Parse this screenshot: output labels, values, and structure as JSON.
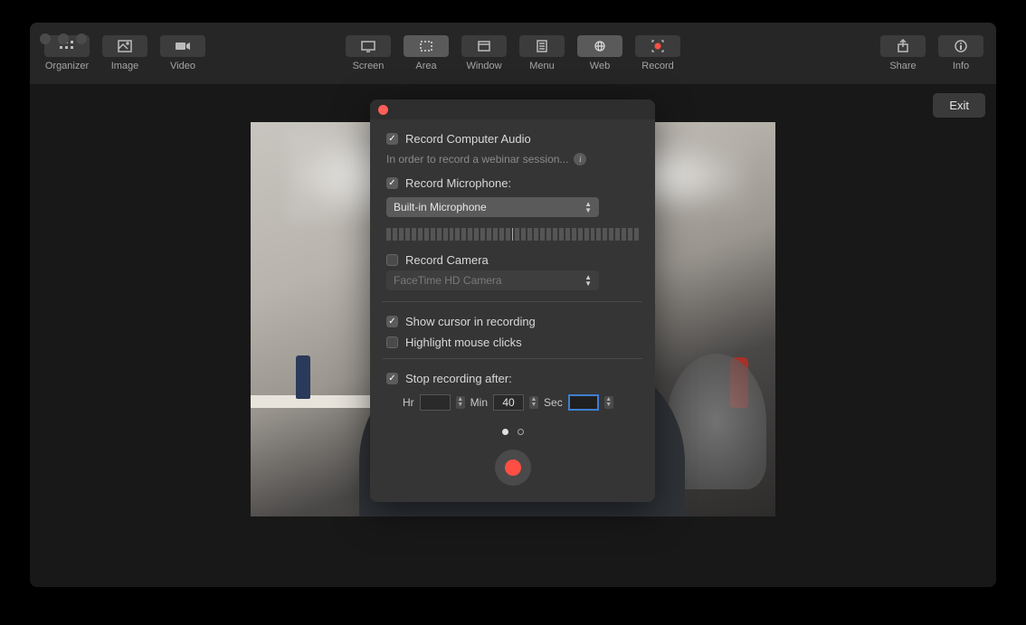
{
  "toolbar": {
    "left": [
      {
        "label": "Organizer",
        "icon": "grid-icon"
      },
      {
        "label": "Image",
        "icon": "image-icon"
      },
      {
        "label": "Video",
        "icon": "video-icon"
      }
    ],
    "center": [
      {
        "label": "Screen",
        "icon": "screen-icon",
        "selected": false
      },
      {
        "label": "Area",
        "icon": "area-icon",
        "selected": true
      },
      {
        "label": "Window",
        "icon": "window-icon",
        "selected": false
      },
      {
        "label": "Menu",
        "icon": "menu-icon",
        "selected": false
      },
      {
        "label": "Web",
        "icon": "web-icon",
        "selected": true
      },
      {
        "label": "Record",
        "icon": "record-icon",
        "selected": false
      }
    ],
    "right": [
      {
        "label": "Share",
        "icon": "share-icon"
      },
      {
        "label": "Info",
        "icon": "info-icon"
      }
    ]
  },
  "exit_label": "Exit",
  "panel": {
    "record_audio_label": "Record Computer Audio",
    "record_audio_checked": true,
    "hint_text": "In order to record a webinar session...",
    "record_mic_label": "Record Microphone:",
    "record_mic_checked": true,
    "mic_selected": "Built-in Microphone",
    "record_camera_label": "Record Camera",
    "record_camera_checked": false,
    "camera_selected": "FaceTime HD Camera",
    "show_cursor_label": "Show cursor in recording",
    "show_cursor_checked": true,
    "highlight_clicks_label": "Highlight mouse clicks",
    "highlight_clicks_checked": false,
    "stop_after_label": "Stop recording after:",
    "stop_after_checked": true,
    "hr_label": "Hr",
    "hr_value": "",
    "min_label": "Min",
    "min_value": "40",
    "sec_label": "Sec",
    "sec_value": ""
  }
}
